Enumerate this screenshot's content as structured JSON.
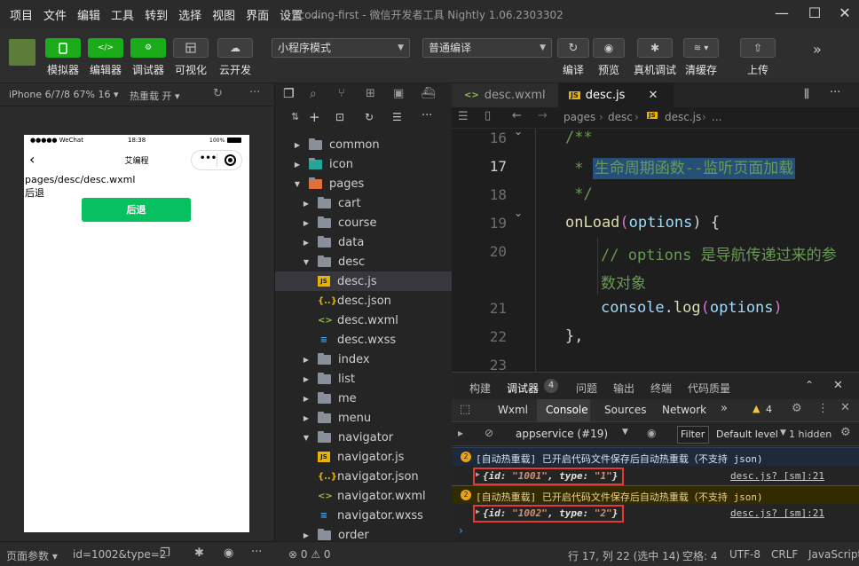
{
  "menu": [
    "项目",
    "文件",
    "编辑",
    "工具",
    "转到",
    "选择",
    "视图",
    "界面",
    "设置",
    "..."
  ],
  "window_title": "icoding-first - 微信开发者工具 Nightly 1.06.2303302",
  "toolbar": {
    "left_buttons": [
      "模拟器",
      "编辑器",
      "调试器",
      "可视化",
      "云开发"
    ],
    "mode_select": "小程序模式",
    "compile_select": "普通编译",
    "right_buttons": [
      "编译",
      "预览",
      "真机调试",
      "清缓存",
      "上传"
    ]
  },
  "simulator": {
    "device": "iPhone 6/7/8 67% 16 ▾",
    "hot_reload": "热重载 开 ▾",
    "status_signal": "●●●●● WeChat",
    "status_time": "18:38",
    "status_battery": "100%",
    "nav_title": "艾编程",
    "page_path": "pages/desc/desc.wxml",
    "back_text": "后退",
    "back_button": "后退"
  },
  "explorer": {
    "items": [
      {
        "label": "common",
        "depth": 1,
        "type": "folder",
        "open": false
      },
      {
        "label": "icon",
        "depth": 1,
        "type": "folder",
        "open": false
      },
      {
        "label": "pages",
        "depth": 1,
        "type": "folder",
        "open": true
      },
      {
        "label": "cart",
        "depth": 2,
        "type": "folder",
        "open": false
      },
      {
        "label": "course",
        "depth": 2,
        "type": "folder",
        "open": false
      },
      {
        "label": "data",
        "depth": 2,
        "type": "folder",
        "open": false
      },
      {
        "label": "desc",
        "depth": 2,
        "type": "folder",
        "open": true
      },
      {
        "label": "desc.js",
        "depth": 3,
        "type": "js",
        "selected": true
      },
      {
        "label": "desc.json",
        "depth": 3,
        "type": "json"
      },
      {
        "label": "desc.wxml",
        "depth": 3,
        "type": "wxml"
      },
      {
        "label": "desc.wxss",
        "depth": 3,
        "type": "wxss"
      },
      {
        "label": "index",
        "depth": 2,
        "type": "folder",
        "open": false
      },
      {
        "label": "list",
        "depth": 2,
        "type": "folder",
        "open": false
      },
      {
        "label": "me",
        "depth": 2,
        "type": "folder",
        "open": false
      },
      {
        "label": "menu",
        "depth": 2,
        "type": "folder",
        "open": false
      },
      {
        "label": "navigator",
        "depth": 2,
        "type": "folder",
        "open": true
      },
      {
        "label": "navigator.js",
        "depth": 3,
        "type": "js"
      },
      {
        "label": "navigator.json",
        "depth": 3,
        "type": "json"
      },
      {
        "label": "navigator.wxml",
        "depth": 3,
        "type": "wxml"
      },
      {
        "label": "navigator.wxss",
        "depth": 3,
        "type": "wxss"
      },
      {
        "label": "order",
        "depth": 2,
        "type": "folder",
        "open": false
      }
    ]
  },
  "editor": {
    "tabs": [
      "desc.wxml",
      "desc.js"
    ],
    "breadcrumb": [
      "pages",
      "desc",
      "desc.js",
      "..."
    ],
    "line_numbers": [
      "16",
      "17",
      "18",
      "19",
      "20",
      "",
      "21",
      "22",
      "23"
    ],
    "code": {
      "l16": "/**",
      "l17_star": " * ",
      "l17_text": "生命周期函数--监听页面加载",
      "l18": " */",
      "l19_fn": "onLoad",
      "l19_open": "(",
      "l19_arg": "options",
      "l19_close": ") {",
      "l20a": "// options 是导航传递过来的参",
      "l20b": "数对象",
      "l21_obj": "console",
      "l21_dot": ".",
      "l21_fn": "log",
      "l21_open": "(",
      "l21_arg": "options",
      "l21_close": ")",
      "l22": "},"
    }
  },
  "debugger": {
    "panel_tabs": [
      "构建",
      "调试器",
      "问题",
      "输出",
      "终端",
      "代码质量"
    ],
    "panel_badge": "4",
    "dev_tabs": [
      "Wxml",
      "Console",
      "Sources",
      "Network"
    ],
    "warn_count": "4",
    "context": "appservice (#19)",
    "filter": "Filter",
    "level": "Default level",
    "hidden": "1 hidden",
    "logs": [
      {
        "type": "info",
        "badge": "2",
        "text": "[自动热重载] 已开启代码文件保存后自动热重载（不支持 json)"
      },
      {
        "type": "obj",
        "id": "\"1001\"",
        "typ": "\"1\"",
        "source": "desc.js? [sm]:21"
      },
      {
        "type": "warn",
        "badge": "2",
        "text": "[自动热重载] 已开启代码文件保存后自动热重载（不支持 json)"
      },
      {
        "type": "obj",
        "id": "\"1002\"",
        "typ": "\"2\"",
        "source": "desc.js? [sm]:21"
      }
    ]
  },
  "status": {
    "page_params": "页面参数 ▾",
    "query": "id=1002&type=2",
    "errors": "⊗ 0 ⚠ 0",
    "position": "行 17, 列 22 (选中 14)",
    "indent": "空格: 4",
    "encoding": "UTF-8",
    "eol": "CRLF",
    "lang": "JavaScript"
  },
  "colors": {
    "accent": "#1aad19",
    "keyword": "#dcdcaa",
    "comment": "#6a9955",
    "string": "#ce9178"
  }
}
